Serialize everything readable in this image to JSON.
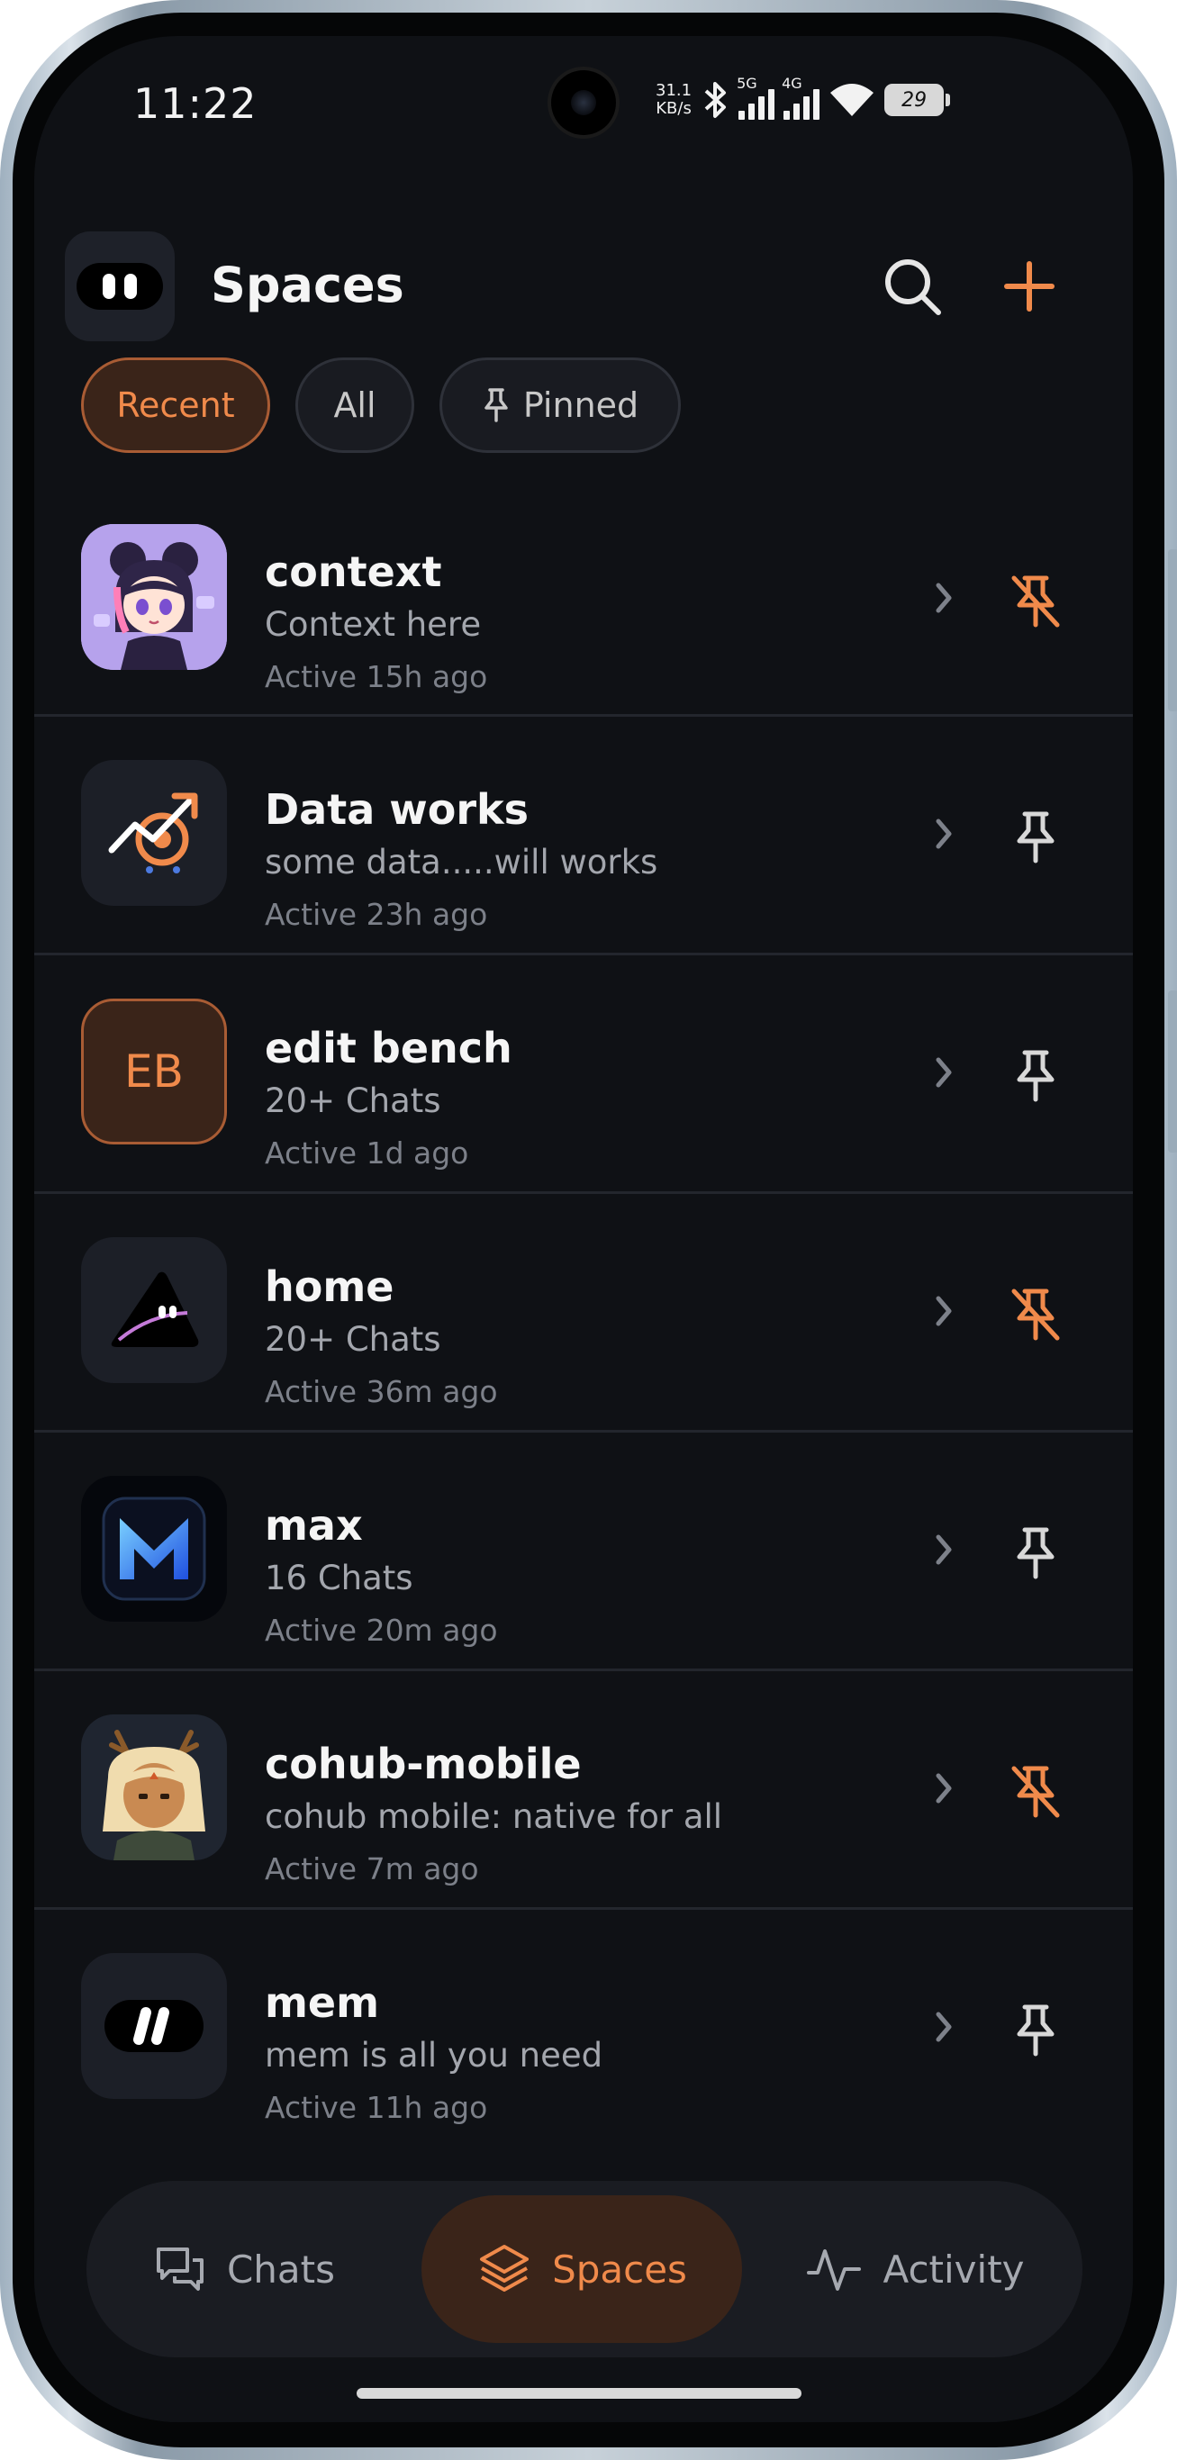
{
  "status_bar": {
    "time": "11:22",
    "net_speed_value": "31.1",
    "net_speed_unit": "KB/s",
    "network_1": "5G",
    "network_2": "4G",
    "battery": "29"
  },
  "header": {
    "title": "Spaces",
    "search_icon": "search-icon",
    "add_icon": "plus-icon"
  },
  "filters": [
    {
      "label": "Recent",
      "active": true
    },
    {
      "label": "All",
      "active": false
    },
    {
      "label": "Pinned",
      "active": false,
      "icon": "pin-icon"
    }
  ],
  "spaces": [
    {
      "title": "context",
      "subtitle": "Context here",
      "activity": "Active 15h ago",
      "avatar": "anime-girl-avatar",
      "pinned": true
    },
    {
      "title": "Data works",
      "subtitle": "some data.....will works",
      "activity": "Active 23h ago",
      "avatar": "analytics-target-icon",
      "pinned": false
    },
    {
      "title": "edit bench",
      "subtitle": "20+ Chats",
      "activity": "Active 1d ago",
      "avatar_initials": "EB",
      "pinned": false
    },
    {
      "title": "home",
      "subtitle": "20+ Chats",
      "activity": "Active 36m ago",
      "avatar": "dark-triangle-logo",
      "pinned": true
    },
    {
      "title": "max",
      "subtitle": "16 Chats",
      "activity": "Active 20m ago",
      "avatar": "m-logo",
      "pinned": false
    },
    {
      "title": "cohub-mobile",
      "subtitle": "cohub mobile: native for all",
      "activity": "Active 7m ago",
      "avatar": "antlered-character-avatar",
      "pinned": true
    },
    {
      "title": "mem",
      "subtitle": "mem is all you need",
      "activity": "Active 11h ago",
      "avatar": "mem-logo",
      "pinned": false
    }
  ],
  "bottom_nav": [
    {
      "label": "Chats",
      "icon": "chats-icon",
      "active": false
    },
    {
      "label": "Spaces",
      "icon": "layers-icon",
      "active": true
    },
    {
      "label": "Activity",
      "icon": "activity-icon",
      "active": false
    }
  ],
  "colors": {
    "accent": "#f08a4b",
    "background": "#0f1115",
    "accent_bg": "#3a2419"
  }
}
